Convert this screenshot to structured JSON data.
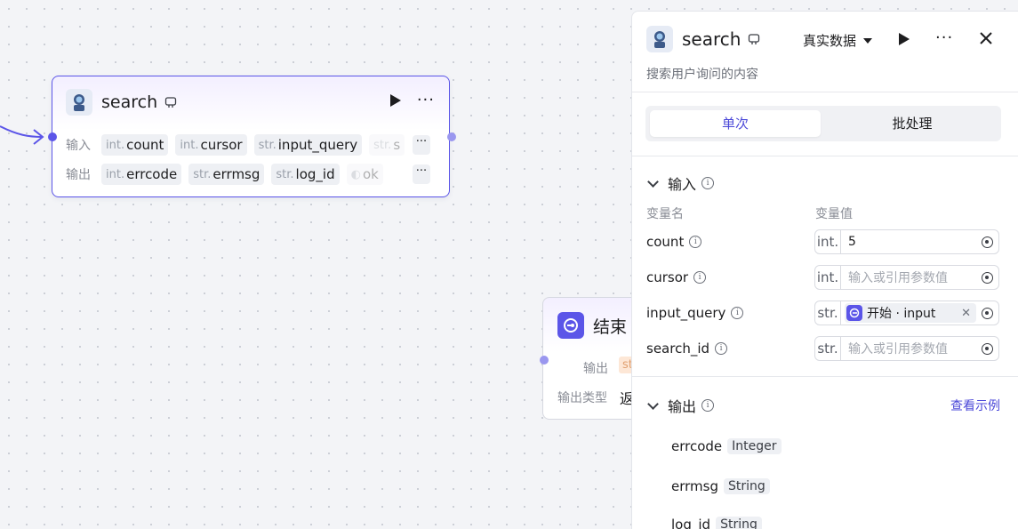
{
  "search_node": {
    "title": "search",
    "input_label": "输入",
    "output_label": "输出",
    "inputs": [
      {
        "type": "int.",
        "name": "count"
      },
      {
        "type": "int.",
        "name": "cursor"
      },
      {
        "type": "str.",
        "name": "input_query"
      },
      {
        "type": "str.",
        "name": "s"
      }
    ],
    "outputs": [
      {
        "type": "int.",
        "name": "errcode"
      },
      {
        "type": "str.",
        "name": "errmsg"
      },
      {
        "type": "str.",
        "name": "log_id"
      },
      {
        "type": "",
        "name": "ok"
      }
    ]
  },
  "end_node": {
    "title": "结束",
    "output_label": "输出",
    "output_type_label": "输出类型",
    "output_type_value": "返",
    "output_tag": "st"
  },
  "panel": {
    "title": "search",
    "env": "真实数据",
    "description": "搜索用户询问的内容",
    "tabs": {
      "single": "单次",
      "batch": "批处理"
    },
    "input_section": "输入",
    "col_name": "变量名",
    "col_value": "变量值",
    "params": [
      {
        "name": "count",
        "type": "int.",
        "value": "5",
        "placeholder": ""
      },
      {
        "name": "cursor",
        "type": "int.",
        "value": "",
        "placeholder": "输入或引用参数值"
      },
      {
        "name": "input_query",
        "type": "str.",
        "ref": "开始 · input"
      },
      {
        "name": "search_id",
        "type": "str.",
        "value": "",
        "placeholder": "输入或引用参数值"
      }
    ],
    "output_section": "输出",
    "view_example": "查看示例",
    "outputs": [
      {
        "name": "errcode",
        "type": "Integer"
      },
      {
        "name": "errmsg",
        "type": "String"
      },
      {
        "name": "log_id",
        "type": "String"
      }
    ]
  },
  "colors": {
    "accent": "#5b55e8",
    "link": "#4b48d8"
  }
}
